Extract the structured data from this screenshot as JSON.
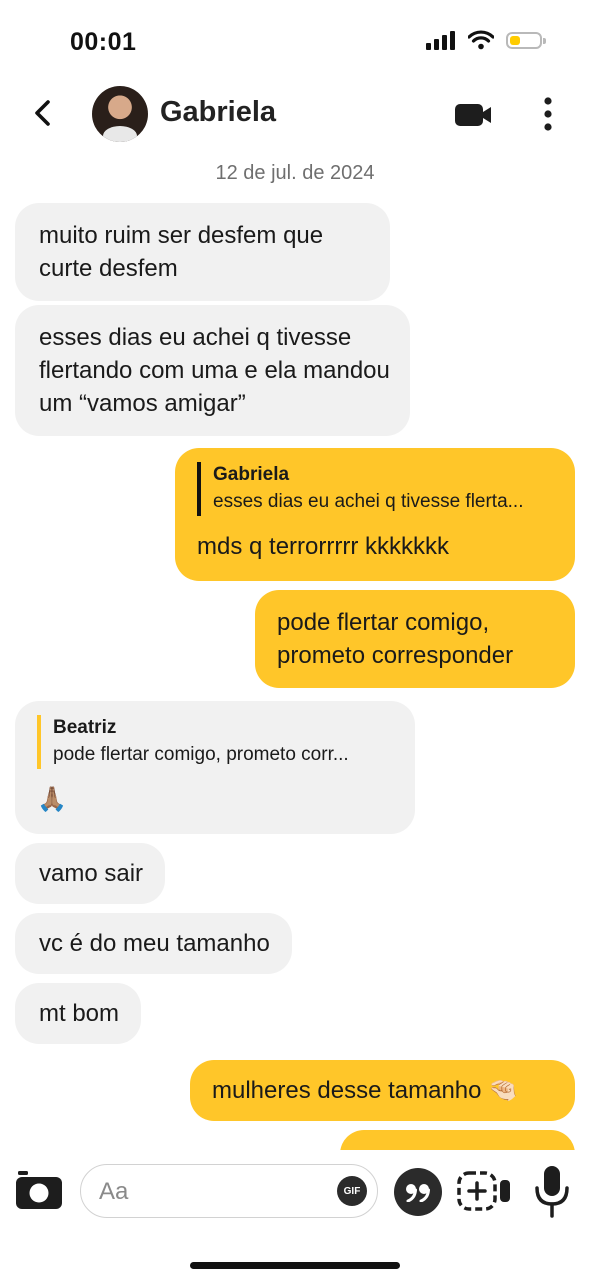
{
  "status_bar": {
    "time": "00:01",
    "battery_level": 0.35
  },
  "header": {
    "contact_name": "Gabriela",
    "icons": {
      "back": "chevron-left-icon",
      "video": "video-camera-icon",
      "more": "more-vertical-icon"
    }
  },
  "date_separator": "12 de jul. de 2024",
  "messages": [
    {
      "from": "them",
      "text": "muito ruim ser desfem que curte desfem"
    },
    {
      "from": "them",
      "text": "esses dias eu achei q tivesse flertando com uma e ela mandou um “vamos amigar”"
    },
    {
      "from": "me",
      "reply_to": {
        "name": "Gabriela",
        "text": "esses dias eu achei q tivesse flerta..."
      },
      "text": "mds q terrorrrrr kkkkkkk"
    },
    {
      "from": "me",
      "text": "pode flertar comigo, prometo corresponder"
    },
    {
      "from": "them",
      "reply_to": {
        "name": "Beatriz",
        "text": "pode flertar comigo, prometo corr..."
      },
      "text": "🙏🏽"
    },
    {
      "from": "them",
      "text": "vamo sair"
    },
    {
      "from": "them",
      "text": "vc é do meu tamanho"
    },
    {
      "from": "them",
      "text": "mt bom"
    },
    {
      "from": "me",
      "text": "mulheres desse tamanho 🤏🏻"
    },
    {
      "from": "me",
      "text": "...?"
    }
  ],
  "composer": {
    "placeholder": "Aa",
    "gif_label": "GIF",
    "icons": {
      "camera": "camera-icon",
      "quote": "quote-icon",
      "media": "camera-roll-icon",
      "mic": "microphone-icon"
    }
  },
  "colors": {
    "accent": "#ffc629",
    "incoming_bubble": "#f1f1f1",
    "text": "#1a1a1a"
  }
}
